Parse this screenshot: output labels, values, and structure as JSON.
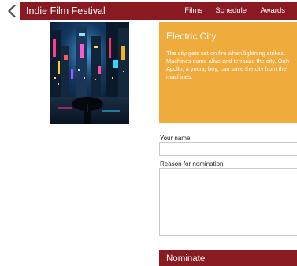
{
  "header": {
    "title": "Indie Film Festival",
    "nav": [
      {
        "label": "Films"
      },
      {
        "label": "Schedule"
      },
      {
        "label": "Awards"
      }
    ]
  },
  "film": {
    "title": "Electric City",
    "description": "The city gets set on fire when lightning strikes. Machines come alive and terrorize the city. Only Apollo, a young boy, can save the city from the machines."
  },
  "form": {
    "name_label": "Your name",
    "name_value": "",
    "reason_label": "Reason for nomination",
    "reason_value": "",
    "submit_label": "Nominate"
  },
  "colors": {
    "header_bg": "#8a1a21",
    "panel_bg": "#efab3c",
    "button_bg": "#8a1a21"
  },
  "icons": {
    "back": "chevron-left-icon"
  }
}
